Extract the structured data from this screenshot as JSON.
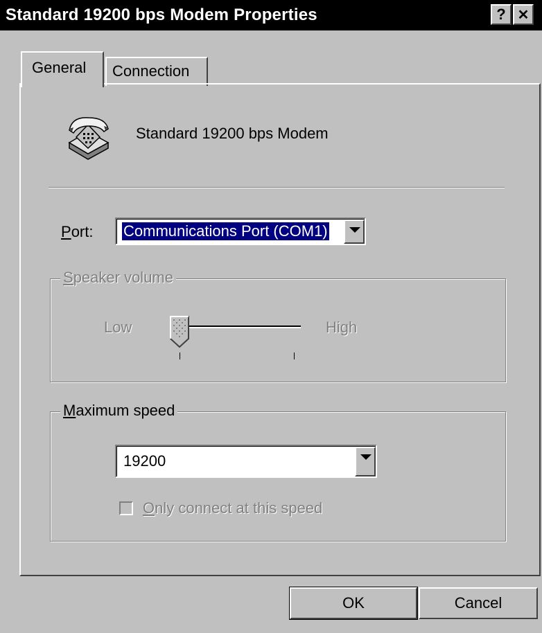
{
  "window": {
    "title": "Standard 19200 bps Modem Properties",
    "help_label": "?",
    "close_label": "✕"
  },
  "tabs": [
    {
      "label": "General",
      "selected": true
    },
    {
      "label": "Connection",
      "selected": false
    }
  ],
  "device": {
    "name": "Standard 19200 bps Modem",
    "icon": "modem-telephone-icon"
  },
  "port": {
    "label_mnemonic": "P",
    "label_rest": "ort:",
    "value": "Communications Port (COM1)"
  },
  "speaker_volume": {
    "legend_mnemonic": "S",
    "legend_rest": "peaker volume",
    "low_label": "Low",
    "high_label": "High",
    "level": 0,
    "enabled": false
  },
  "max_speed": {
    "legend_mnemonic": "M",
    "legend_rest": "aximum speed",
    "value": "19200",
    "checkbox_mnemonic": "O",
    "checkbox_rest": "nly connect at this speed",
    "checkbox_checked": false,
    "checkbox_enabled": false
  },
  "buttons": {
    "ok": "OK",
    "cancel": "Cancel"
  }
}
